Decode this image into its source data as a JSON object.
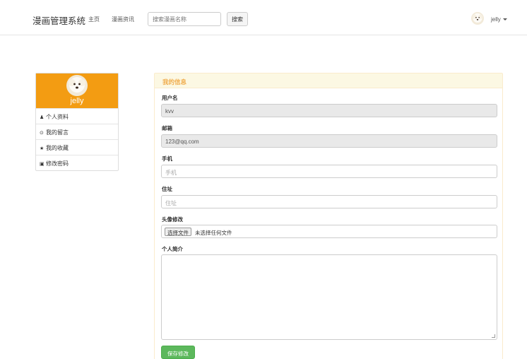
{
  "navbar": {
    "brand": "漫画管理系统",
    "links": [
      "主页",
      "漫画资讯"
    ],
    "search_placeholder": "搜索漫画名称",
    "search_button": "搜索",
    "user_name": "jelly"
  },
  "sidebar": {
    "user_name": "jelly",
    "items": [
      {
        "icon": "user-icon",
        "glyph": "♟",
        "label": "个人资料"
      },
      {
        "icon": "comment-icon",
        "glyph": "⊙",
        "label": "我的留言"
      },
      {
        "icon": "star-icon",
        "glyph": "★",
        "label": "我的收藏"
      },
      {
        "icon": "lock-icon",
        "glyph": "▣",
        "label": "修改密码"
      }
    ]
  },
  "panel": {
    "title": "我的信息",
    "fields": {
      "username_label": "用户名",
      "username_value": "kvv",
      "email_label": "邮箱",
      "email_value": "123@qq.com",
      "phone_label": "手机",
      "phone_placeholder": "手机",
      "address_label": "住址",
      "address_placeholder": "住址",
      "avatar_label": "头像修改",
      "file_button": "选择文件",
      "file_status": "未选择任何文件",
      "bio_label": "个人简介",
      "bio_value": ""
    },
    "save_button": "保存修改"
  },
  "colors": {
    "accent_orange": "#f39c12",
    "panel_title": "#f0ad4e",
    "save_green": "#5cb85c"
  }
}
